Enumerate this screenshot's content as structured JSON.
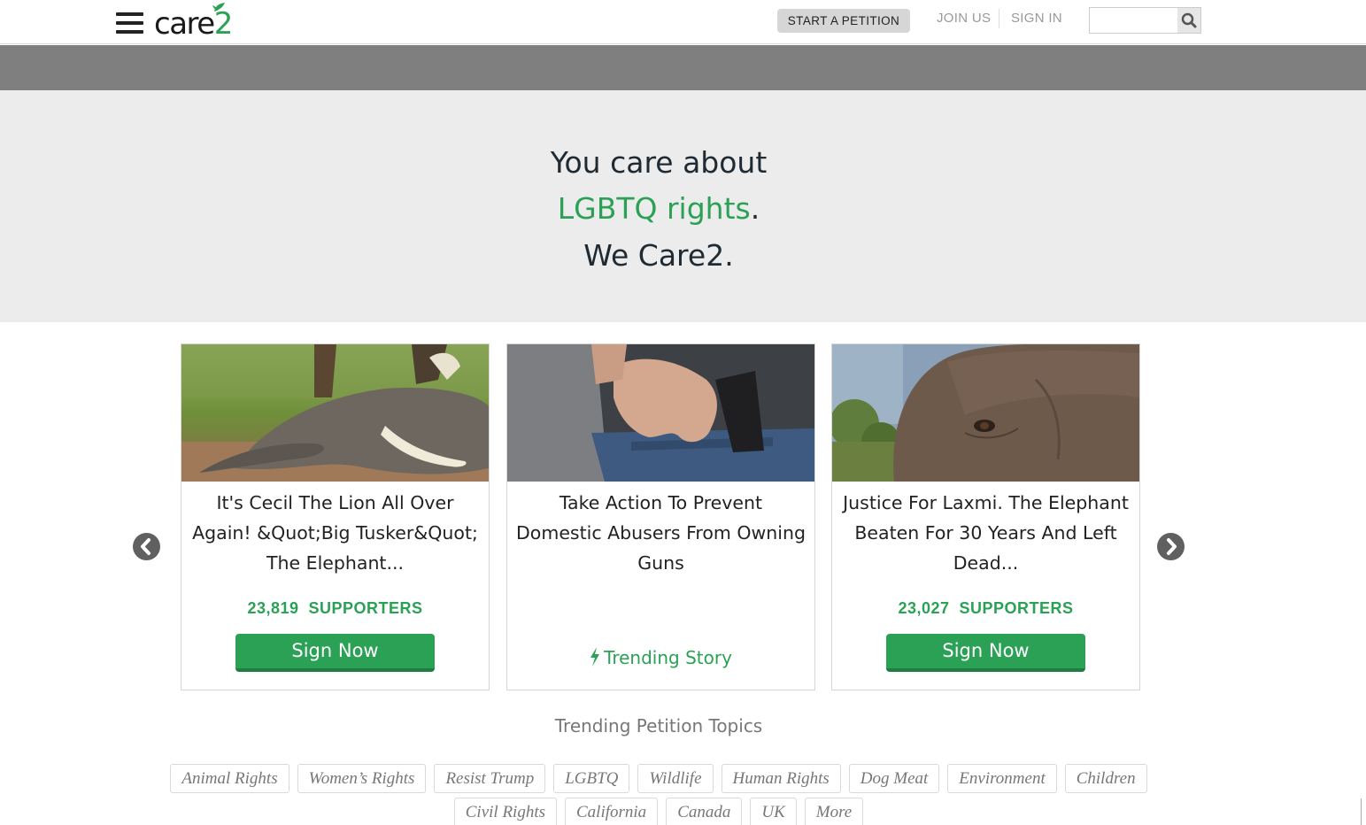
{
  "header": {
    "logo_text": "care",
    "logo_number": "2",
    "start_petition_label": "START A PETITION",
    "join_label": "JOIN US",
    "signin_label": "SIGN IN",
    "search_placeholder": ""
  },
  "hero": {
    "line1": "You care about",
    "topic": "LGBTQ rights",
    "topic_suffix": ".",
    "line3": "We Care2."
  },
  "cards": [
    {
      "title": "It's Cecil The Lion All Over Again! &Quot;Big Tusker&Quot; The Elephant...",
      "supporters_count": "23,819",
      "supporters_label": "SUPPORTERS",
      "button_label": "Sign Now"
    },
    {
      "title": "Take Action To Prevent Domestic Abusers From Owning Guns",
      "trending_label": "Trending Story"
    },
    {
      "title": "Justice For Laxmi. The Elephant Beaten For 30 Years And Left Dead...",
      "supporters_count": "23,027",
      "supporters_label": "SUPPORTERS",
      "button_label": "Sign Now"
    }
  ],
  "topics": {
    "title": "Trending Petition Topics",
    "row1": [
      "Animal Rights",
      "Women’s Rights",
      "Resist Trump",
      "LGBTQ",
      "Wildlife",
      "Human Rights",
      "Dog Meat",
      "Environment",
      "Children"
    ],
    "row2": [
      "Civil Rights",
      "California",
      "Canada",
      "UK",
      "More"
    ]
  },
  "colors": {
    "brand_green": "#2aa155",
    "hero_bg": "#ececec",
    "band_grey": "#7f7f7f"
  },
  "icons": [
    "menu-icon",
    "search-icon",
    "chevron-left-icon",
    "chevron-right-icon",
    "bolt-icon"
  ]
}
